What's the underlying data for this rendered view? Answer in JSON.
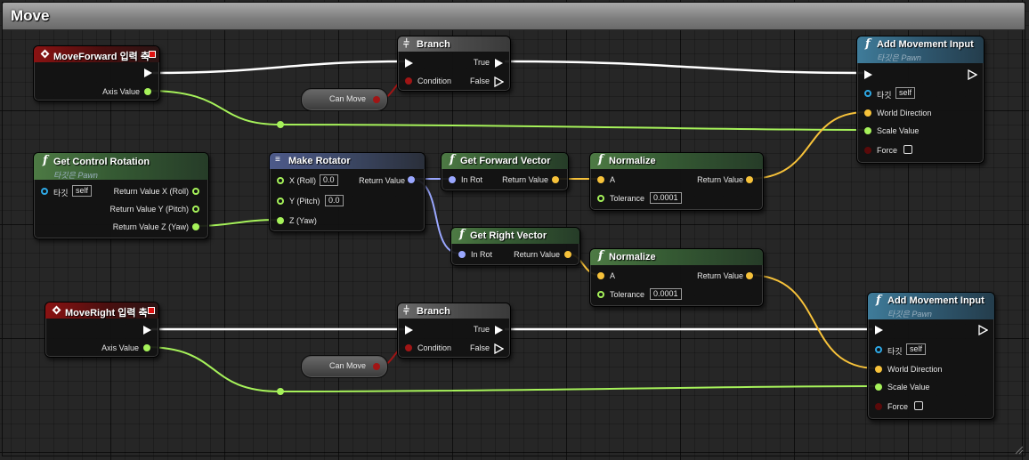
{
  "graph_title": "Move",
  "colors": {
    "exec": "#ffffff",
    "float": "#a6f25a",
    "vector": "#f7c23a",
    "rotator": "#9aa7ff",
    "bool": "#a11515",
    "object": "#2ea8e5"
  },
  "nodes": {
    "move_forward": {
      "title": "MoveForward 입력 축",
      "axis_value": "Axis Value"
    },
    "branch_1": {
      "title": "Branch",
      "condition": "Condition",
      "true": "True",
      "false": "False"
    },
    "can_move_1": {
      "label": "Can Move"
    },
    "add_movement_1": {
      "title": "Add Movement Input",
      "subtitle": "타깃은 Pawn",
      "target": "타깃",
      "target_value": "self",
      "world_direction": "World Direction",
      "scale_value": "Scale Value",
      "force": "Force"
    },
    "get_control_rotation": {
      "title": "Get Control Rotation",
      "subtitle": "타깃은 Pawn",
      "target": "타깃",
      "target_value": "self",
      "rv_x": "Return Value X (Roll)",
      "rv_y": "Return Value Y (Pitch)",
      "rv_z": "Return Value Z (Yaw)"
    },
    "make_rotator": {
      "title": "Make Rotator",
      "x": "X (Roll)",
      "x_value": "0.0",
      "y": "Y (Pitch)",
      "y_value": "0.0",
      "z": "Z (Yaw)",
      "return_value": "Return Value"
    },
    "get_forward_vector": {
      "title": "Get Forward Vector",
      "in_rot": "In Rot",
      "return_value": "Return Value"
    },
    "normalize_1": {
      "title": "Normalize",
      "a": "A",
      "tolerance": "Tolerance",
      "tolerance_value": "0.0001",
      "return_value": "Return Value"
    },
    "get_right_vector": {
      "title": "Get Right Vector",
      "in_rot": "In Rot",
      "return_value": "Return Value"
    },
    "normalize_2": {
      "title": "Normalize",
      "a": "A",
      "tolerance": "Tolerance",
      "tolerance_value": "0.0001",
      "return_value": "Return Value"
    },
    "move_right": {
      "title": "MoveRight 입력 축",
      "axis_value": "Axis Value"
    },
    "branch_2": {
      "title": "Branch",
      "condition": "Condition",
      "true": "True",
      "false": "False"
    },
    "can_move_2": {
      "label": "Can Move"
    },
    "add_movement_2": {
      "title": "Add Movement Input",
      "subtitle": "타깃은 Pawn",
      "target": "타깃",
      "target_value": "self",
      "world_direction": "World Direction",
      "scale_value": "Scale Value",
      "force": "Force"
    }
  }
}
